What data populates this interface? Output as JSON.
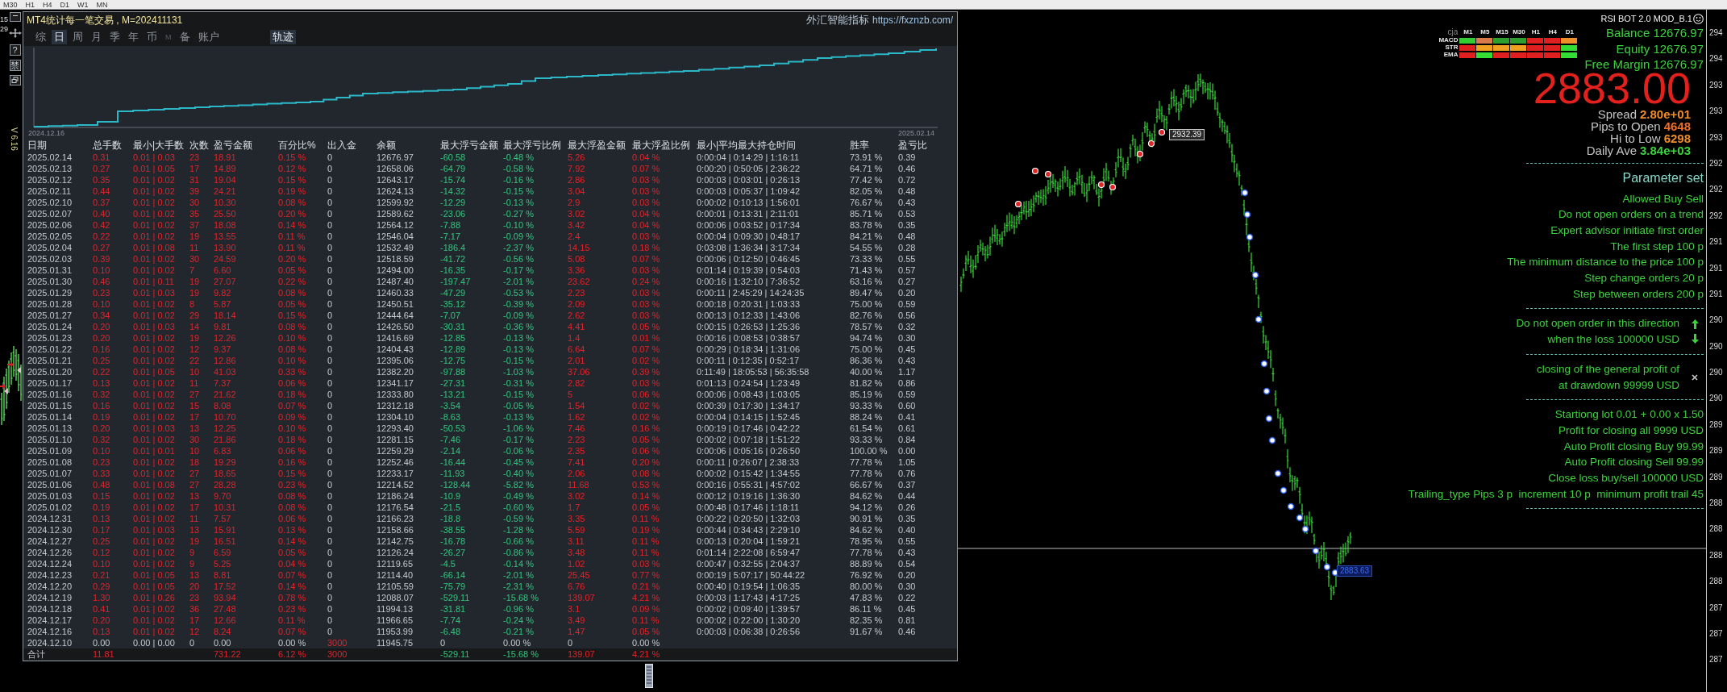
{
  "toolbar": {
    "timeframes": [
      "M30",
      "H1",
      "H4",
      "D1",
      "W1",
      "MN"
    ]
  },
  "left_strip": {
    "price_labels": [
      "15",
      "29"
    ],
    "buttons": [
      "?",
      "禁"
    ],
    "version": "V 6.16"
  },
  "stats_panel": {
    "title": "MT4统计每一笔交易 , M=202411131",
    "brand": "外汇智能指标",
    "url": "https://fxznzb.com/",
    "tabs": [
      {
        "label": "综",
        "selected": false,
        "disabled": false
      },
      {
        "label": "日",
        "selected": true,
        "disabled": false
      },
      {
        "label": "周",
        "selected": false,
        "disabled": false
      },
      {
        "label": "月",
        "selected": false,
        "disabled": false
      },
      {
        "label": "季",
        "selected": false,
        "disabled": false
      },
      {
        "label": "年",
        "selected": false,
        "disabled": false
      },
      {
        "label": "币",
        "selected": false,
        "disabled": false
      },
      {
        "label": "M",
        "selected": false,
        "disabled": true
      },
      {
        "label": "备",
        "selected": false,
        "disabled": false
      },
      {
        "label": "账户",
        "selected": false,
        "disabled": false
      }
    ],
    "trace_button": {
      "label": "轨迹",
      "on": true
    },
    "equity_chart": {
      "start_label": "2024.12.16",
      "end_label": "2025.02.14"
    },
    "table": {
      "columns": [
        {
          "label": "日期",
          "kind": "plain"
        },
        {
          "label": "总手数",
          "kind": "gain"
        },
        {
          "label": "最小|大手数",
          "kind": "gain"
        },
        {
          "label": "次数",
          "kind": "gain"
        },
        {
          "label": "盈亏金额",
          "kind": "gain"
        },
        {
          "label": "百分比%",
          "kind": "gain"
        },
        {
          "label": "出入金",
          "kind": "flow"
        },
        {
          "label": "余额",
          "kind": "plain"
        },
        {
          "label": "最大浮亏金额",
          "kind": "loss"
        },
        {
          "label": "最大浮亏比例",
          "kind": "loss"
        },
        {
          "label": "最大浮盈金额",
          "kind": "gain"
        },
        {
          "label": "最大浮盈比例",
          "kind": "gain"
        },
        {
          "label": "最小|平均最大持仓时间",
          "kind": "plain"
        },
        {
          "label": "胜率",
          "kind": "plain"
        },
        {
          "label": "盈亏比",
          "kind": "plain"
        }
      ],
      "rows": [
        {
          "kind": "trade",
          "cells": [
            "2025.02.14",
            "0.31",
            "0.01 | 0.03",
            "23",
            "18.91",
            "0.15 %",
            "0",
            "12676.97",
            "-60.58",
            "-0.48 %",
            "5.26",
            "0.04 %",
            "0:00:04 | 0:14:29 | 1:16:11",
            "73.91 %",
            "0.39"
          ]
        },
        {
          "kind": "trade",
          "cells": [
            "2025.02.13",
            "0.27",
            "0.01 | 0.05",
            "17",
            "14.89",
            "0.12 %",
            "0",
            "12658.06",
            "-64.79",
            "-0.58 %",
            "7.92",
            "0.07 %",
            "0:00:20 | 0:50:05 | 2:36:22",
            "64.71 %",
            "0.46"
          ]
        },
        {
          "kind": "trade",
          "cells": [
            "2025.02.12",
            "0.35",
            "0.01 | 0.02",
            "31",
            "19.04",
            "0.15 %",
            "0",
            "12643.17",
            "-15.74",
            "-0.16 %",
            "2.86",
            "0.03 %",
            "0:00:03 | 0:03:01 | 0:26:13",
            "77.42 %",
            "0.72"
          ]
        },
        {
          "kind": "trade",
          "cells": [
            "2025.02.11",
            "0.44",
            "0.01 | 0.02",
            "39",
            "24.21",
            "0.19 %",
            "0",
            "12624.13",
            "-14.32",
            "-0.15 %",
            "3.04",
            "0.03 %",
            "0:00:03 | 0:05:37 | 1:09:42",
            "82.05 %",
            "0.48"
          ]
        },
        {
          "kind": "trade",
          "cells": [
            "2025.02.10",
            "0.37",
            "0.01 | 0.02",
            "30",
            "10.30",
            "0.08 %",
            "0",
            "12599.92",
            "-12.29",
            "-0.13 %",
            "2.9",
            "0.03 %",
            "0:00:02 | 0:10:13 | 1:56:01",
            "76.67 %",
            "0.43"
          ]
        },
        {
          "kind": "trade",
          "cells": [
            "2025.02.07",
            "0.40",
            "0.01 | 0.02",
            "35",
            "25.50",
            "0.20 %",
            "0",
            "12589.62",
            "-23.06",
            "-0.27 %",
            "3.02",
            "0.04 %",
            "0:00:01 | 0:13:31 | 2:11:01",
            "85.71 %",
            "0.53"
          ]
        },
        {
          "kind": "trade",
          "cells": [
            "2025.02.06",
            "0.42",
            "0.01 | 0.02",
            "37",
            "18.08",
            "0.14 %",
            "0",
            "12564.12",
            "-7.88",
            "-0.10 %",
            "3.42",
            "0.04 %",
            "0:00:06 | 0:03:52 | 0:17:34",
            "83.78 %",
            "0.35"
          ]
        },
        {
          "kind": "trade",
          "cells": [
            "2025.02.05",
            "0.22",
            "0.01 | 0.02",
            "19",
            "13.55",
            "0.11 %",
            "0",
            "12546.04",
            "-7.17",
            "-0.09 %",
            "2.4",
            "0.03 %",
            "0:00:04 | 0:09:30 | 0:48:17",
            "84.21 %",
            "0.48"
          ]
        },
        {
          "kind": "trade",
          "cells": [
            "2025.02.04",
            "0.27",
            "0.01 | 0.08",
            "11",
            "13.90",
            "0.11 %",
            "0",
            "12532.49",
            "-186.4",
            "-2.37 %",
            "14.15",
            "0.18 %",
            "0:03:08 | 1:36:34 | 3:17:34",
            "54.55 %",
            "0.28"
          ]
        },
        {
          "kind": "trade",
          "cells": [
            "2025.02.03",
            "0.39",
            "0.01 | 0.02",
            "30",
            "24.59",
            "0.20 %",
            "0",
            "12518.59",
            "-41.72",
            "-0.56 %",
            "5.08",
            "0.07 %",
            "0:00:06 | 0:12:50 | 0:46:45",
            "73.33 %",
            "0.55"
          ]
        },
        {
          "kind": "trade",
          "cells": [
            "2025.01.31",
            "0.10",
            "0.01 | 0.02",
            "7",
            "6.60",
            "0.05 %",
            "0",
            "12494.00",
            "-16.35",
            "-0.17 %",
            "3.36",
            "0.03 %",
            "0:01:14 | 0:19:39 | 0:54:03",
            "71.43 %",
            "0.57"
          ]
        },
        {
          "kind": "trade",
          "cells": [
            "2025.01.30",
            "0.46",
            "0.01 | 0.11",
            "19",
            "27.07",
            "0.22 %",
            "0",
            "12487.40",
            "-197.47",
            "-2.01 %",
            "23.62",
            "0.24 %",
            "0:00:16 | 1:32:10 | 7:36:52",
            "63.16 %",
            "0.27"
          ]
        },
        {
          "kind": "trade",
          "cells": [
            "2025.01.29",
            "0.23",
            "0.01 | 0.03",
            "19",
            "9.82",
            "0.08 %",
            "0",
            "12460.33",
            "-47.29",
            "-0.53 %",
            "2.23",
            "0.03 %",
            "0:00:11 | 2:45:29 | 14:24:35",
            "89.47 %",
            "0.20"
          ]
        },
        {
          "kind": "trade",
          "cells": [
            "2025.01.28",
            "0.10",
            "0.01 | 0.02",
            "8",
            "5.87",
            "0.05 %",
            "0",
            "12450.51",
            "-35.12",
            "-0.39 %",
            "2.09",
            "0.03 %",
            "0:00:18 | 0:20:31 | 1:03:33",
            "75.00 %",
            "0.59"
          ]
        },
        {
          "kind": "trade",
          "cells": [
            "2025.01.27",
            "0.34",
            "0.01 | 0.02",
            "29",
            "18.14",
            "0.15 %",
            "0",
            "12444.64",
            "-7.07",
            "-0.09 %",
            "2.62",
            "0.03 %",
            "0:00:13 | 0:12:33 | 1:43:06",
            "82.76 %",
            "0.56"
          ]
        },
        {
          "kind": "trade",
          "cells": [
            "2025.01.24",
            "0.20",
            "0.01 | 0.03",
            "14",
            "9.81",
            "0.08 %",
            "0",
            "12426.50",
            "-30.31",
            "-0.36 %",
            "4.41",
            "0.05 %",
            "0:00:15 | 0:26:53 | 1:25:36",
            "78.57 %",
            "0.32"
          ]
        },
        {
          "kind": "trade",
          "cells": [
            "2025.01.23",
            "0.20",
            "0.01 | 0.02",
            "19",
            "12.26",
            "0.10 %",
            "0",
            "12416.69",
            "-12.85",
            "-0.13 %",
            "1.4",
            "0.01 %",
            "0:00:16 | 0:08:53 | 0:38:57",
            "94.74 %",
            "0.30"
          ]
        },
        {
          "kind": "trade",
          "cells": [
            "2025.01.22",
            "0.16",
            "0.01 | 0.02",
            "12",
            "9.37",
            "0.08 %",
            "0",
            "12404.43",
            "-12.89",
            "-0.13 %",
            "6.64",
            "0.07 %",
            "0:00:29 | 0:18:34 | 1:31:06",
            "75.00 %",
            "0.45"
          ]
        },
        {
          "kind": "trade",
          "cells": [
            "2025.01.21",
            "0.25",
            "0.01 | 0.02",
            "22",
            "12.86",
            "0.10 %",
            "0",
            "12395.06",
            "-12.75",
            "-0.15 %",
            "2.01",
            "0.02 %",
            "0:00:11 | 0:12:35 | 0:52:17",
            "86.36 %",
            "0.43"
          ]
        },
        {
          "kind": "trade",
          "cells": [
            "2025.01.20",
            "0.22",
            "0.01 | 0.05",
            "10",
            "41.03",
            "0.33 %",
            "0",
            "12382.20",
            "-97.88",
            "-1.03 %",
            "37.06",
            "0.39 %",
            "0:11:49 | 18:05:53 | 56:35:58",
            "40.00 %",
            "1.17"
          ]
        },
        {
          "kind": "trade",
          "cells": [
            "2025.01.17",
            "0.13",
            "0.01 | 0.02",
            "11",
            "7.37",
            "0.06 %",
            "0",
            "12341.17",
            "-27.31",
            "-0.31 %",
            "2.82",
            "0.03 %",
            "0:01:13 | 0:24:54 | 1:23:49",
            "81.82 %",
            "0.86"
          ]
        },
        {
          "kind": "trade",
          "cells": [
            "2025.01.16",
            "0.32",
            "0.01 | 0.02",
            "27",
            "21.62",
            "0.18 %",
            "0",
            "12333.80",
            "-13.21",
            "-0.15 %",
            "5",
            "0.06 %",
            "0:00:06 | 0:08:43 | 1:03:05",
            "85.19 %",
            "0.59"
          ]
        },
        {
          "kind": "trade",
          "cells": [
            "2025.01.15",
            "0.16",
            "0.01 | 0.02",
            "15",
            "8.08",
            "0.07 %",
            "0",
            "12312.18",
            "-3.54",
            "-0.05 %",
            "1.54",
            "0.02 %",
            "0:00:39 | 0:17:30 | 1:34:17",
            "93.33 %",
            "0.60"
          ]
        },
        {
          "kind": "trade",
          "cells": [
            "2025.01.14",
            "0.19",
            "0.01 | 0.02",
            "17",
            "10.70",
            "0.09 %",
            "0",
            "12304.10",
            "-8.63",
            "-0.13 %",
            "1.62",
            "0.02 %",
            "0:00:04 | 0:14:15 | 1:52:45",
            "88.24 %",
            "0.41"
          ]
        },
        {
          "kind": "trade",
          "cells": [
            "2025.01.13",
            "0.20",
            "0.01 | 0.03",
            "13",
            "12.25",
            "0.10 %",
            "0",
            "12293.40",
            "-50.53",
            "-1.06 %",
            "7.46",
            "0.16 %",
            "0:00:19 | 0:17:46 | 0:42:22",
            "61.54 %",
            "0.61"
          ]
        },
        {
          "kind": "trade",
          "cells": [
            "2025.01.10",
            "0.32",
            "0.01 | 0.02",
            "30",
            "21.86",
            "0.18 %",
            "0",
            "12281.15",
            "-7.46",
            "-0.17 %",
            "2.23",
            "0.05 %",
            "0:00:02 | 0:07:18 | 1:51:22",
            "93.33 %",
            "0.84"
          ]
        },
        {
          "kind": "trade",
          "cells": [
            "2025.01.09",
            "0.10",
            "0.01 | 0.01",
            "10",
            "6.83",
            "0.06 %",
            "0",
            "12259.29",
            "-2.14",
            "-0.06 %",
            "2.35",
            "0.06 %",
            "0:00:06 | 0:05:16 | 0:26:50",
            "100.00 %",
            "0.00"
          ]
        },
        {
          "kind": "trade",
          "cells": [
            "2025.01.08",
            "0.23",
            "0.01 | 0.02",
            "18",
            "19.29",
            "0.16 %",
            "0",
            "12252.46",
            "-16.44",
            "-0.45 %",
            "7.41",
            "0.20 %",
            "0:00:11 | 0:26:07 | 2:38:33",
            "77.78 %",
            "1.05"
          ]
        },
        {
          "kind": "trade",
          "cells": [
            "2025.01.07",
            "0.33",
            "0.01 | 0.02",
            "27",
            "18.65",
            "0.15 %",
            "0",
            "12233.17",
            "-11.93",
            "-0.40 %",
            "2.06",
            "0.08 %",
            "0:00:02 | 0:15:42 | 1:34:55",
            "77.78 %",
            "0.76"
          ]
        },
        {
          "kind": "trade",
          "cells": [
            "2025.01.06",
            "0.48",
            "0.01 | 0.08",
            "27",
            "28.28",
            "0.23 %",
            "0",
            "12214.52",
            "-128.44",
            "-5.82 %",
            "11.68",
            "0.53 %",
            "0:00:16 | 0:55:31 | 4:57:02",
            "66.67 %",
            "0.37"
          ]
        },
        {
          "kind": "trade",
          "cells": [
            "2025.01.03",
            "0.15",
            "0.01 | 0.02",
            "13",
            "9.70",
            "0.08 %",
            "0",
            "12186.24",
            "-10.9",
            "-0.49 %",
            "3.02",
            "0.14 %",
            "0:00:12 | 0:19:16 | 1:36:30",
            "84.62 %",
            "0.44"
          ]
        },
        {
          "kind": "trade",
          "cells": [
            "2025.01.02",
            "0.19",
            "0.01 | 0.02",
            "17",
            "10.31",
            "0.08 %",
            "0",
            "12176.54",
            "-21.5",
            "-0.60 %",
            "1.7",
            "0.05 %",
            "0:00:48 | 0:17:46 | 1:18:11",
            "94.12 %",
            "0.26"
          ]
        },
        {
          "kind": "trade",
          "cells": [
            "2024.12.31",
            "0.13",
            "0.01 | 0.02",
            "11",
            "7.57",
            "0.06 %",
            "0",
            "12166.23",
            "-18.8",
            "-0.59 %",
            "3.35",
            "0.11 %",
            "0:00:22 | 0:20:50 | 1:32:03",
            "90.91 %",
            "0.35"
          ]
        },
        {
          "kind": "trade",
          "cells": [
            "2024.12.30",
            "0.17",
            "0.01 | 0.03",
            "13",
            "15.91",
            "0.13 %",
            "0",
            "12158.66",
            "-38.55",
            "-1.28 %",
            "5.59",
            "0.19 %",
            "0:00:44 | 0:34:43 | 2:29:10",
            "84.62 %",
            "0.40"
          ]
        },
        {
          "kind": "trade",
          "cells": [
            "2024.12.27",
            "0.25",
            "0.01 | 0.02",
            "19",
            "16.51",
            "0.14 %",
            "0",
            "12142.75",
            "-16.78",
            "-0.66 %",
            "3.11",
            "0.11 %",
            "0:00:13 | 0:20:04 | 1:59:21",
            "78.95 %",
            "0.55"
          ]
        },
        {
          "kind": "trade",
          "cells": [
            "2024.12.26",
            "0.12",
            "0.01 | 0.02",
            "9",
            "6.59",
            "0.05 %",
            "0",
            "12126.24",
            "-26.27",
            "-0.86 %",
            "3.48",
            "0.11 %",
            "0:01:14 | 2:22:08 | 6:59:47",
            "77.78 %",
            "0.43"
          ]
        },
        {
          "kind": "trade",
          "cells": [
            "2024.12.24",
            "0.10",
            "0.01 | 0.02",
            "9",
            "5.25",
            "0.04 %",
            "0",
            "12119.65",
            "-4.5",
            "-0.14 %",
            "1.02",
            "0.03 %",
            "0:00:47 | 0:32:55 | 2:04:37",
            "88.89 %",
            "0.54"
          ]
        },
        {
          "kind": "trade",
          "cells": [
            "2024.12.23",
            "0.21",
            "0.01 | 0.05",
            "13",
            "8.81",
            "0.07 %",
            "0",
            "12114.40",
            "-66.14",
            "-2.01 %",
            "25.45",
            "0.77 %",
            "0:00:19 | 5:07:17 | 50:44:22",
            "76.92 %",
            "0.20"
          ]
        },
        {
          "kind": "trade",
          "cells": [
            "2024.12.20",
            "0.29",
            "0.01 | 0.05",
            "20",
            "17.52",
            "0.14 %",
            "0",
            "12105.59",
            "-75.79",
            "-2.31 %",
            "6.76",
            "0.21 %",
            "0:00:40 | 0:19:54 | 1:06:35",
            "80.00 %",
            "0.30"
          ]
        },
        {
          "kind": "trade",
          "cells": [
            "2024.12.19",
            "1.30",
            "0.01 | 0.26",
            "23",
            "93.94",
            "0.78 %",
            "0",
            "12088.07",
            "-529.11",
            "-15.68 %",
            "139.07",
            "4.21 %",
            "0:00:03 | 1:17:43 | 4:17:25",
            "47.83 %",
            "0.22"
          ]
        },
        {
          "kind": "trade",
          "cells": [
            "2024.12.18",
            "0.41",
            "0.01 | 0.02",
            "36",
            "27.48",
            "0.23 %",
            "0",
            "11994.13",
            "-31.81",
            "-0.96 %",
            "3.1",
            "0.09 %",
            "0:00:02 | 0:09:40 | 1:39:57",
            "86.11 %",
            "0.45"
          ]
        },
        {
          "kind": "trade",
          "cells": [
            "2024.12.17",
            "0.20",
            "0.01 | 0.02",
            "17",
            "12.66",
            "0.11 %",
            "0",
            "11966.65",
            "-7.74",
            "-0.24 %",
            "3.49",
            "0.11 %",
            "0:00:02 | 0:22:00 | 1:30:20",
            "82.35 %",
            "0.81"
          ]
        },
        {
          "kind": "trade",
          "cells": [
            "2024.12.16",
            "0.13",
            "0.01 | 0.02",
            "12",
            "8.24",
            "0.07 %",
            "0",
            "11953.99",
            "-6.48",
            "-0.21 %",
            "1.47",
            "0.05 %",
            "0:00:03 | 0:06:38 | 0:26:56",
            "91.67 %",
            "0.46"
          ]
        },
        {
          "kind": "deposit",
          "cells": [
            "2024.12.10",
            "0.00",
            "0.00 | 0.00",
            "0",
            "0.00",
            "0.00 %",
            "3000",
            "11945.75",
            "0",
            "0.00 %",
            "0",
            "0.00 %"
          ]
        },
        {
          "kind": "total",
          "cells": [
            "合计",
            "11.81",
            "",
            "",
            "731.22",
            "6.12 %",
            "3000",
            "",
            "-529.11",
            "-15.68 %",
            "139.07",
            "4.21 %"
          ]
        }
      ]
    }
  },
  "price_chart": {
    "tags": [
      {
        "kind": "high",
        "text": "2932.39"
      },
      {
        "kind": "bid",
        "text": "2883.63"
      }
    ],
    "axis_labels": [
      "294",
      "294",
      "293",
      "293",
      "293",
      "292",
      "292",
      "292",
      "291",
      "291",
      "291",
      "290",
      "290",
      "290",
      "290",
      "289",
      "289",
      "289",
      "288",
      "288",
      "288",
      "288",
      "287",
      "287",
      "287"
    ]
  },
  "bot_panel": {
    "title": "RSI BOT 2.0 MOD_B.1",
    "signal_grid": {
      "corner": "cja",
      "timeframes": [
        "M1",
        "M5",
        "M15",
        "M30",
        "H1",
        "H4",
        "D1"
      ],
      "rows": [
        {
          "label": "MACD",
          "cells": [
            {
              "color": "#33cc33"
            },
            {
              "color": "#d97a4a"
            },
            {
              "color": "#2e9e2e"
            },
            {
              "color": "#2e9e2e"
            },
            {
              "color": "#e02020"
            },
            {
              "color": "#e02020"
            },
            {
              "color": "#ee8f2a"
            }
          ]
        },
        {
          "label": "STR",
          "cells": [
            {
              "color": "#e02020"
            },
            {
              "color": "#f0a020"
            },
            {
              "color": "#f0a020"
            },
            {
              "color": "#f0a020"
            },
            {
              "color": "#e02020"
            },
            {
              "color": "#e02020"
            },
            {
              "color": "#33dd33"
            }
          ]
        },
        {
          "label": "EMA",
          "cells": [
            {
              "color": "#e02020"
            },
            {
              "color": "#33dd33"
            },
            {
              "color": "#e02020"
            },
            {
              "color": "#e02020"
            },
            {
              "color": "#e02020"
            },
            {
              "color": "#e02020"
            },
            {
              "color": "#33dd33"
            }
          ]
        }
      ]
    },
    "account": [
      "Balance 12676.97",
      "Equity 12676.97",
      "Free Margin 12676.97"
    ],
    "price": "2883.00",
    "stats": [
      {
        "label": "Spread",
        "value": "2.80e+01",
        "color": "#f08c28"
      },
      {
        "label": "Pips to Open",
        "value": "4648",
        "color": "#f07028"
      },
      {
        "label": "Hi to Low",
        "value": "6298",
        "color": "#f08c28"
      },
      {
        "label": "Daily Ave",
        "value": "3.84e+03",
        "color": "#3cd23c"
      }
    ],
    "parameters": {
      "title": "Parameter set",
      "groups": [
        {
          "kind": "plain",
          "lines": [
            "Allowed Buy Sell",
            "Do not open orders on a trend",
            "Expert advisor initiate first order",
            "The first step 100 p",
            "The minimum distance to the price 100 p",
            "Step change orders 20 p",
            "Step between orders 200 p"
          ]
        },
        {
          "kind": "direction",
          "lines": [
            "Do not open order in this direction",
            "when the loss 100000 USD"
          ]
        },
        {
          "kind": "close",
          "lines": [
            "closing of the general profit of",
            "at drawdown 99999 USD"
          ]
        },
        {
          "kind": "plain",
          "lines": [
            "Startiong lot 0.01 + 0.00 x 1.50",
            "Profit for closing all 9999 USD",
            "Auto Profit closing Buy 99.99",
            "Auto Profit closing Sell 99.99",
            "Close loss buy/sell 100000 USD",
            "Trailing_type Pips 3 p  increment 10 p  minimum profit trail 45"
          ]
        }
      ]
    }
  }
}
